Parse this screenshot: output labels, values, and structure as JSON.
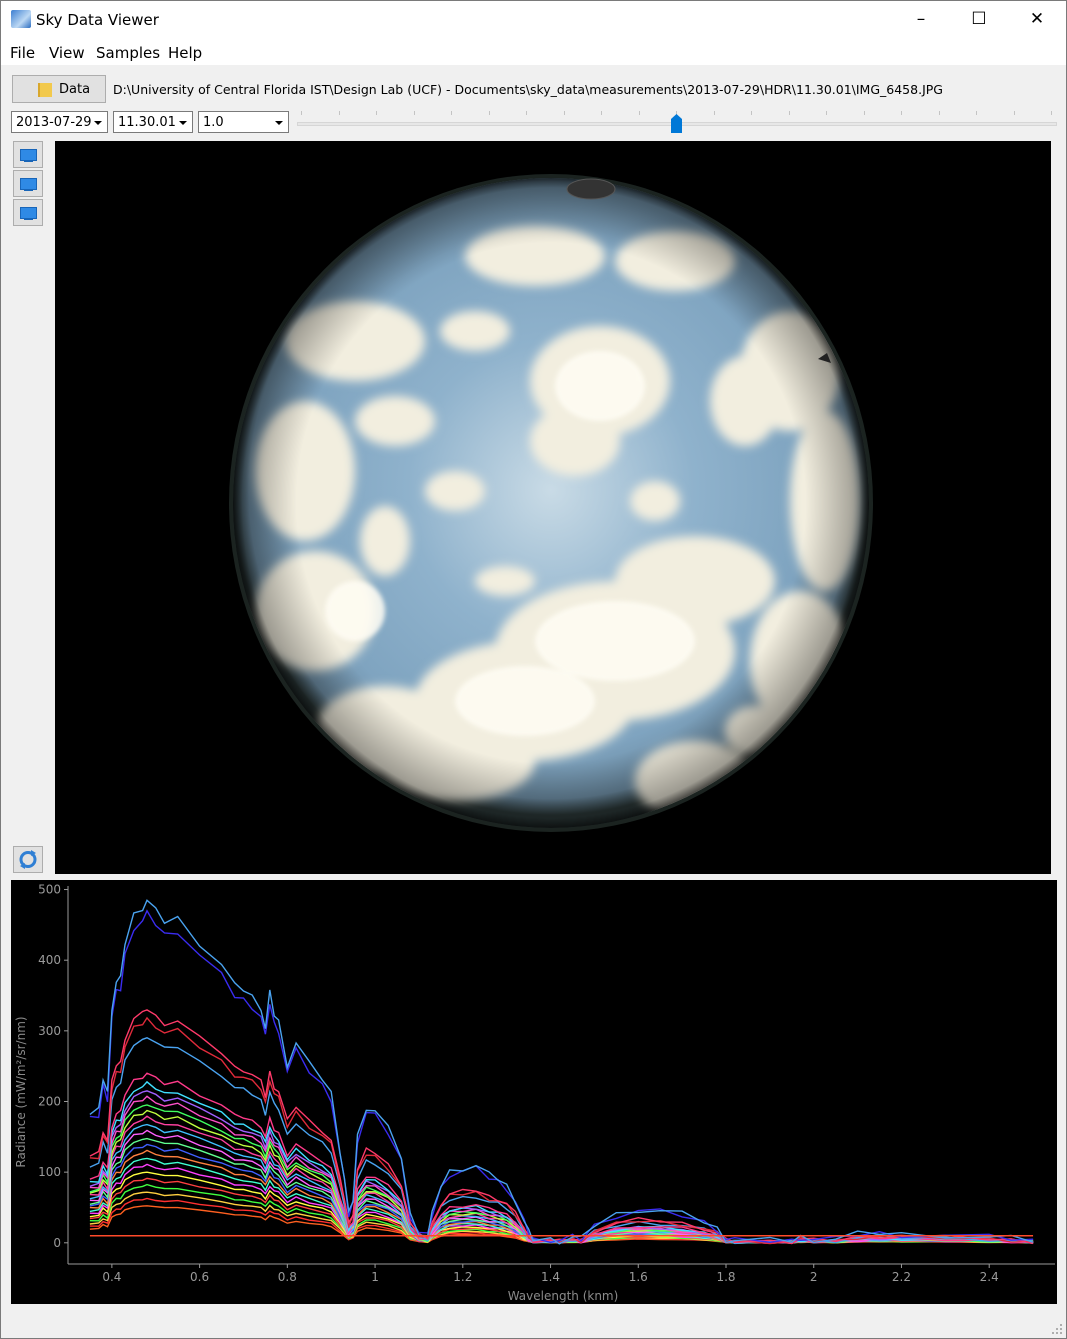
{
  "window": {
    "title": "Sky Data Viewer",
    "controls": {
      "minimize": "–",
      "maximize": "☐",
      "close": "✕"
    }
  },
  "menu": [
    "File",
    "View",
    "Samples",
    "Help"
  ],
  "toolbar": {
    "data_button_label": "Data",
    "path": "D:\\University of Central Florida IST\\Design Lab (UCF) - Documents\\sky_data\\measurements\\2013-07-29\\HDR\\11.30.01\\IMG_6458.JPG",
    "date_select": "2013-07-29",
    "time_select": "11.30.01",
    "exposure_select": "1.0",
    "timeline_slider_value": 0.5
  },
  "sidebar": {
    "view_buttons": [
      "monitor-icon",
      "monitor-icon",
      "monitor-icon"
    ],
    "refresh_icon": "refresh-icon"
  },
  "colors": {
    "sky": "#9cbad0",
    "cloud": "#f4f1e4",
    "plot_bg": "#000000",
    "axis": "#9a9a9a"
  },
  "chart_data": {
    "type": "line",
    "title": "",
    "xlabel": "Wavelength (knm)",
    "ylabel": "Radiance (mW/m²/sr/nm)",
    "xlim": [
      0.3,
      2.55
    ],
    "ylim": [
      -30,
      505
    ],
    "xticks": [
      "0.4",
      "0.6",
      "0.8",
      "1",
      "1.2",
      "1.4",
      "1.6",
      "1.8",
      "2",
      "2.2",
      "2.4"
    ],
    "yticks": [
      "0",
      "100",
      "200",
      "300",
      "400",
      "500"
    ],
    "grid": false,
    "legend": "none",
    "base_profile": {
      "x": [
        0.35,
        0.37,
        0.38,
        0.39,
        0.4,
        0.41,
        0.42,
        0.43,
        0.45,
        0.47,
        0.48,
        0.5,
        0.52,
        0.55,
        0.6,
        0.65,
        0.68,
        0.7,
        0.72,
        0.74,
        0.75,
        0.76,
        0.77,
        0.78,
        0.8,
        0.82,
        0.85,
        0.88,
        0.9,
        0.92,
        0.93,
        0.94,
        0.95,
        0.96,
        0.98,
        1.0,
        1.03,
        1.06,
        1.08,
        1.1,
        1.12,
        1.13,
        1.15,
        1.17,
        1.2,
        1.23,
        1.26,
        1.28,
        1.3,
        1.32,
        1.34,
        1.35,
        1.36,
        1.4,
        1.42,
        1.45,
        1.47,
        1.5,
        1.55,
        1.6,
        1.65,
        1.7,
        1.75,
        1.78,
        1.8,
        1.82,
        1.9,
        1.95,
        1.97,
        2.0,
        2.05,
        2.1,
        2.15,
        2.2,
        2.3,
        2.4,
        2.45,
        2.5
      ],
      "y": [
        180,
        185,
        230,
        210,
        330,
        365,
        370,
        420,
        460,
        470,
        480,
        465,
        450,
        455,
        420,
        390,
        360,
        355,
        345,
        330,
        300,
        350,
        320,
        310,
        250,
        280,
        250,
        230,
        210,
        130,
        90,
        40,
        60,
        150,
        190,
        185,
        160,
        120,
        40,
        15,
        10,
        40,
        80,
        100,
        105,
        108,
        95,
        90,
        80,
        60,
        30,
        15,
        5,
        5,
        3,
        8,
        5,
        25,
        40,
        47,
        45,
        40,
        30,
        20,
        5,
        3,
        3,
        3,
        8,
        5,
        5,
        12,
        14,
        12,
        11,
        8,
        6,
        3
      ]
    },
    "series": [
      {
        "color": "#4aa3f0",
        "scale": 1.01
      },
      {
        "color": "#3a2cf0",
        "scale": 0.97
      },
      {
        "color": "#ff3a6a",
        "scale": 0.69
      },
      {
        "color": "#e02a3a",
        "scale": 0.66
      },
      {
        "color": "#4aa3f0",
        "scale": 0.61
      },
      {
        "color": "#ff3a8a",
        "scale": 0.5
      },
      {
        "color": "#40e0ff",
        "scale": 0.47
      },
      {
        "color": "#a060ff",
        "scale": 0.45
      },
      {
        "color": "#ff50c8",
        "scale": 0.43
      },
      {
        "color": "#40ff60",
        "scale": 0.41
      },
      {
        "color": "#c0ff40",
        "scale": 0.39
      },
      {
        "color": "#ff40a0",
        "scale": 0.37
      },
      {
        "color": "#40c0ff",
        "scale": 0.35
      },
      {
        "color": "#ff60ff",
        "scale": 0.33
      },
      {
        "color": "#60ff90",
        "scale": 0.31
      },
      {
        "color": "#4060ff",
        "scale": 0.29
      },
      {
        "color": "#ff8040",
        "scale": 0.27
      },
      {
        "color": "#40ffd0",
        "scale": 0.25
      },
      {
        "color": "#ff40ff",
        "scale": 0.23
      },
      {
        "color": "#ffff40",
        "scale": 0.21
      },
      {
        "color": "#ff4040",
        "scale": 0.19
      },
      {
        "color": "#40ff40",
        "scale": 0.17
      },
      {
        "color": "#ffd040",
        "scale": 0.15
      },
      {
        "color": "#ff3030",
        "scale": 0.13
      },
      {
        "color": "#ff6020",
        "scale": 0.11
      }
    ],
    "flat_line": {
      "color": "#ff4a2a",
      "value": 10
    }
  }
}
